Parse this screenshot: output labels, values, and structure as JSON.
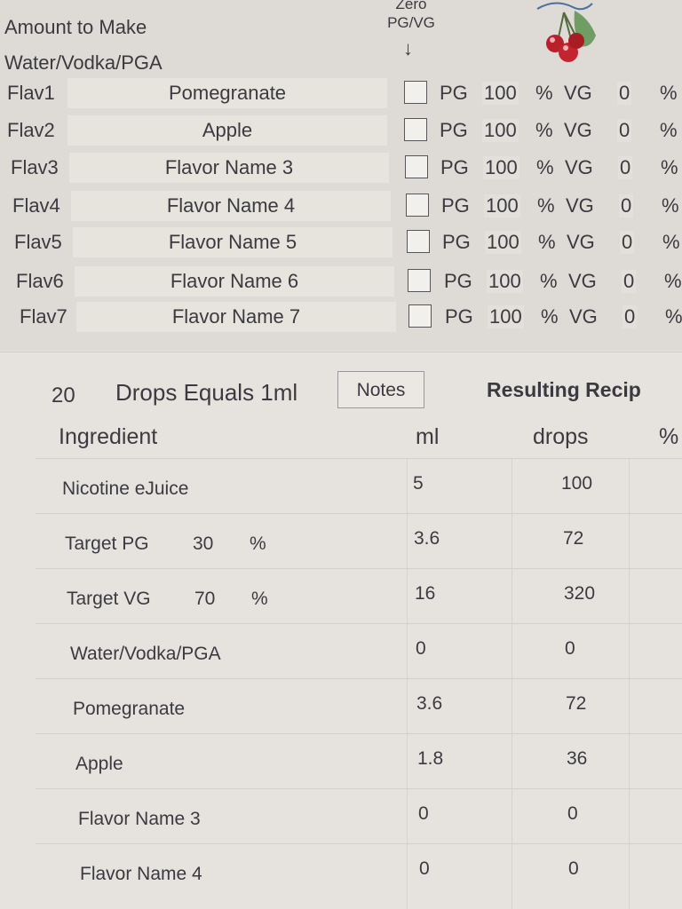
{
  "header": {
    "amount_label": "Amount to Make",
    "water_label": "Water/Vodka/PGA",
    "zero_label_top": "Zero",
    "zero_label_bottom": "PG/VG",
    "arrow": "↓",
    "logo_icon": "cherry-icon"
  },
  "flavors": [
    {
      "key": "Flav1",
      "name": "Pomegranate",
      "pg_label": "PG",
      "pg": "100",
      "pct": "%",
      "vg_label": "VG",
      "vg": "0",
      "pct2": "%"
    },
    {
      "key": "Flav2",
      "name": "Apple",
      "pg_label": "PG",
      "pg": "100",
      "pct": "%",
      "vg_label": "VG",
      "vg": "0",
      "pct2": "%"
    },
    {
      "key": "Flav3",
      "name": "Flavor Name 3",
      "pg_label": "PG",
      "pg": "100",
      "pct": "%",
      "vg_label": "VG",
      "vg": "0",
      "pct2": "%"
    },
    {
      "key": "Flav4",
      "name": "Flavor Name 4",
      "pg_label": "PG",
      "pg": "100",
      "pct": "%",
      "vg_label": "VG",
      "vg": "0",
      "pct2": "%"
    },
    {
      "key": "Flav5",
      "name": "Flavor Name 5",
      "pg_label": "PG",
      "pg": "100",
      "pct": "%",
      "vg_label": "VG",
      "vg": "0",
      "pct2": "%"
    },
    {
      "key": "Flav6",
      "name": "Flavor Name 6",
      "pg_label": "PG",
      "pg": "100",
      "pct": "%",
      "vg_label": "VG",
      "vg": "0",
      "pct2": "%"
    },
    {
      "key": "Flav7",
      "name": "Flavor Name 7",
      "pg_label": "PG",
      "pg": "100",
      "pct": "%",
      "vg_label": "VG",
      "vg": "0",
      "pct2": "%"
    }
  ],
  "drops": {
    "count": "20",
    "label": "Drops Equals 1ml",
    "notes_button": "Notes",
    "result_title": "Resulting Recip"
  },
  "columns": {
    "ingredient": "Ingredient",
    "ml": "ml",
    "drops": "drops",
    "percent": "%"
  },
  "recipe": [
    {
      "name": "Nicotine eJuice",
      "pct": "",
      "pct_sign": "",
      "ml": "5",
      "drops": "100"
    },
    {
      "name": "Target PG",
      "pct": "30",
      "pct_sign": "%",
      "ml": "3.6",
      "drops": "72"
    },
    {
      "name": "Target VG",
      "pct": "70",
      "pct_sign": "%",
      "ml": "16",
      "drops": "320"
    },
    {
      "name": "Water/Vodka/PGA",
      "pct": "",
      "pct_sign": "",
      "ml": "0",
      "drops": "0"
    },
    {
      "name": "Pomegranate",
      "pct": "",
      "pct_sign": "",
      "ml": "3.6",
      "drops": "72"
    },
    {
      "name": "Apple",
      "pct": "",
      "pct_sign": "",
      "ml": "1.8",
      "drops": "36"
    },
    {
      "name": "Flavor Name 3",
      "pct": "",
      "pct_sign": "",
      "ml": "0",
      "drops": "0"
    },
    {
      "name": "Flavor Name 4",
      "pct": "",
      "pct_sign": "",
      "ml": "0",
      "drops": "0"
    }
  ]
}
